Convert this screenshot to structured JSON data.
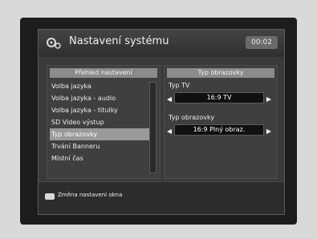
{
  "header": {
    "title": "Nastavení systému",
    "clock": "00:02",
    "icon": "gear-icon"
  },
  "left_panel": {
    "title": "Přehled nastavení",
    "items": [
      "Volba jazyka",
      "Volba jazyka - audio",
      "Volba jazyka - titulky",
      "SD Video výstup",
      "Typ obrazovky",
      "Trvání Banneru",
      "Místní čas"
    ],
    "selected_index": 4
  },
  "right_panel": {
    "title": "Typ obrazovky",
    "fields": [
      {
        "label": "Typ TV",
        "value": "16:9 TV"
      },
      {
        "label": "Typ obrazovky",
        "value": "16:9 Plný obraz."
      }
    ]
  },
  "footer": {
    "text": "Změna nastavení okna"
  }
}
